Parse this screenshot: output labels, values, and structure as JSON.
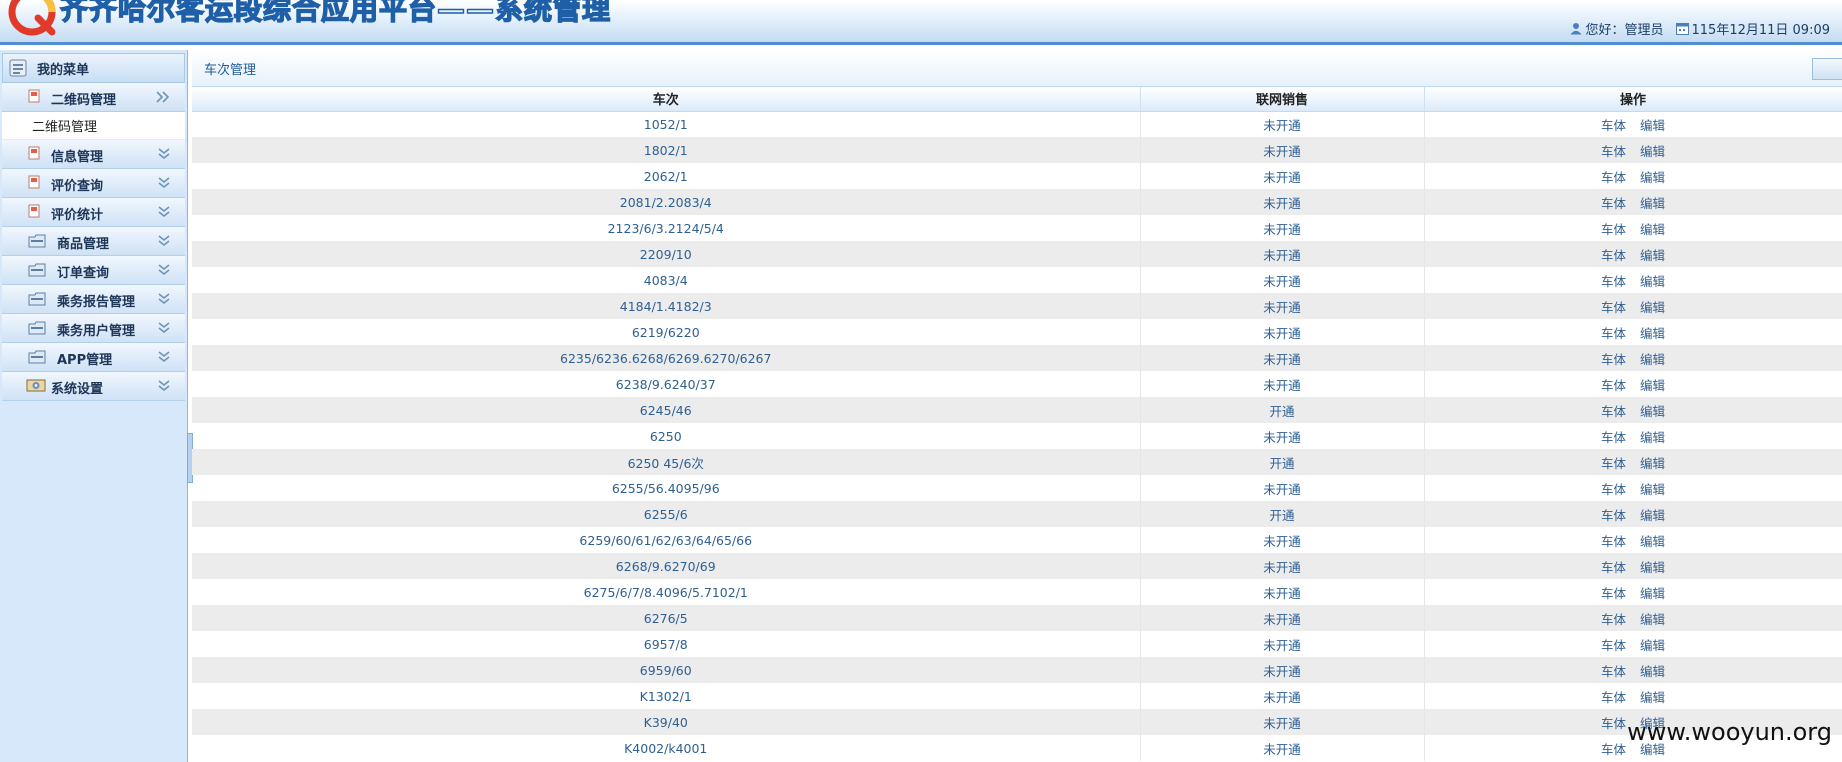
{
  "header": {
    "title": "齐齐哈尔客运段综合应用平台——系统管理",
    "greeting": "您好：管理员",
    "date": "115年12月11日 09:09"
  },
  "sidebar": {
    "title": "我的菜单",
    "items": [
      {
        "label": "二维码管理",
        "icon": "doc-icon",
        "level": 2,
        "expanded": true
      },
      {
        "label": "二维码管理",
        "submenu": true
      },
      {
        "label": "信息管理",
        "icon": "doc-icon",
        "level": 2
      },
      {
        "label": "评价查询",
        "icon": "doc-icon",
        "level": 2
      },
      {
        "label": "评价统计",
        "icon": "doc-icon",
        "level": 2
      },
      {
        "label": "商品管理",
        "icon": "folder-icon",
        "level": 1
      },
      {
        "label": "订单查询",
        "icon": "folder-icon",
        "level": 1
      },
      {
        "label": "乘务报告管理",
        "icon": "folder-icon",
        "level": 1
      },
      {
        "label": "乘务用户管理",
        "icon": "folder-icon",
        "level": 1
      },
      {
        "label": "APP管理",
        "icon": "folder-icon",
        "level": 1
      },
      {
        "label": "系统设置",
        "icon": "settings-icon",
        "level": 1
      }
    ]
  },
  "main": {
    "section_title": "车次管理",
    "columns": [
      "车次",
      "联网销售",
      "操作"
    ],
    "action_labels": {
      "car": "车体",
      "edit": "编辑"
    },
    "rows": [
      {
        "train": "1052/1",
        "status": "未开通"
      },
      {
        "train": "1802/1",
        "status": "未开通"
      },
      {
        "train": "2062/1",
        "status": "未开通"
      },
      {
        "train": "2081/2.2083/4",
        "status": "未开通"
      },
      {
        "train": "2123/6/3.2124/5/4",
        "status": "未开通"
      },
      {
        "train": "2209/10",
        "status": "未开通"
      },
      {
        "train": "4083/4",
        "status": "未开通"
      },
      {
        "train": "4184/1.4182/3",
        "status": "未开通"
      },
      {
        "train": "6219/6220",
        "status": "未开通"
      },
      {
        "train": "6235/6236.6268/6269.6270/6267",
        "status": "未开通"
      },
      {
        "train": "6238/9.6240/37",
        "status": "未开通"
      },
      {
        "train": "6245/46",
        "status": "开通"
      },
      {
        "train": "6250",
        "status": "未开通"
      },
      {
        "train": "6250 45/6次",
        "status": "开通"
      },
      {
        "train": "6255/56.4095/96",
        "status": "未开通"
      },
      {
        "train": "6255/6",
        "status": "开通"
      },
      {
        "train": "6259/60/61/62/63/64/65/66",
        "status": "未开通"
      },
      {
        "train": "6268/9.6270/69",
        "status": "未开通"
      },
      {
        "train": "6275/6/7/8.4096/5.7102/1",
        "status": "未开通"
      },
      {
        "train": "6276/5",
        "status": "未开通"
      },
      {
        "train": "6957/8",
        "status": "未开通"
      },
      {
        "train": "6959/60",
        "status": "未开通"
      },
      {
        "train": "K1302/1",
        "status": "未开通"
      },
      {
        "train": "K39/40",
        "status": "未开通"
      },
      {
        "train": "K4002/k4001",
        "status": "未开通"
      }
    ]
  },
  "watermark": "www.wooyun.org"
}
